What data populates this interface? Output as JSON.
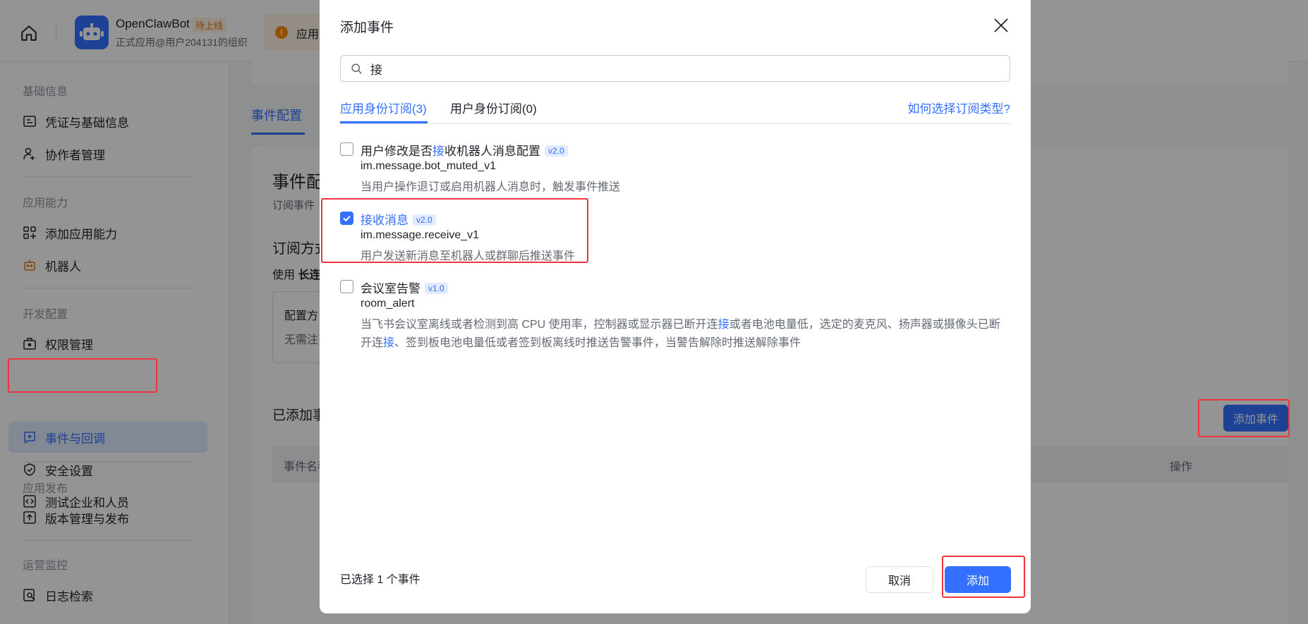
{
  "app": {
    "name": "OpenClawBot",
    "status_badge": "待上线",
    "subtitle": "正式应用@用户204131的组织",
    "notice_text": "应用"
  },
  "sidebar": {
    "groups": [
      {
        "label": "基础信息",
        "items": [
          {
            "label": "凭证与基础信息",
            "icon": "id-card-icon"
          },
          {
            "label": "协作者管理",
            "icon": "user-add-icon"
          }
        ]
      },
      {
        "label": "应用能力",
        "items": [
          {
            "label": "添加应用能力",
            "icon": "grid-add-icon"
          },
          {
            "label": "机器人",
            "icon": "robot-icon"
          }
        ]
      },
      {
        "label": "开发配置",
        "items": [
          {
            "label": "权限管理",
            "icon": "briefcase-icon"
          },
          {
            "label": "事件与回调",
            "icon": "event-icon",
            "active": true
          },
          {
            "label": "安全设置",
            "icon": "shield-icon"
          },
          {
            "label": "测试企业和人员",
            "icon": "code-box-icon"
          }
        ]
      },
      {
        "label": "应用发布",
        "items": [
          {
            "label": "版本管理与发布",
            "icon": "upload-box-icon"
          }
        ]
      },
      {
        "label": "运营监控",
        "items": [
          {
            "label": "日志检索",
            "icon": "search-doc-icon"
          }
        ]
      }
    ]
  },
  "main": {
    "tab_label": "事件配置",
    "section_title": "事件配",
    "section_sub": "订阅事件",
    "subscribe_title": "订阅方式",
    "use_text_prefix": "使用",
    "use_text_bold": "长连",
    "config_box_title": "配置方",
    "config_box_text": "无需注",
    "added_title": "已添加事",
    "table_col_name": "事件名称",
    "table_col_action": "操作",
    "add_event_button": "添加事件"
  },
  "modal": {
    "title": "添加事件",
    "search_value": "接",
    "tabs": [
      {
        "label": "应用身份订阅(3)",
        "active": true
      },
      {
        "label": "用户身份订阅(0)",
        "active": false
      }
    ],
    "help_link": "如何选择订阅类型?",
    "events": [
      {
        "name_before": "用户修改是否",
        "name_highlight": "接",
        "name_after": "收机器人消息配置",
        "version": "v2.0",
        "key": "im.message.bot_muted_v1",
        "desc_before": "当用户操作退订或启用机器人消息时，触发事件推送",
        "checked": false
      },
      {
        "name_before": "",
        "name_highlight": "接收消息",
        "name_after": "",
        "version": "v2.0",
        "key": "im.message.receive_v1",
        "desc_before": "用户发送新消息至机器人或群聊后推送事件",
        "checked": true
      },
      {
        "name_before": "会议室告警",
        "name_highlight": "",
        "name_after": "",
        "version": "v1.0",
        "key": "room_alert",
        "desc_before": "当飞书会议室离线或者检测到高 CPU 使用率，控制器或显示器已断开连",
        "desc_hl1": "接",
        "desc_mid": "或者电池电量低，选定的麦克风、扬声器或摄像头已断开连",
        "desc_hl2": "接",
        "desc_after": "、签到板电池电量低或者签到板离线时推送告警事件，当警告解除时推送解除事件",
        "checked": false
      }
    ],
    "selected_count_text": "已选择 1 个事件",
    "cancel_button": "取消",
    "add_button": "添加"
  },
  "colors": {
    "primary": "#3370ff",
    "highlight_box": "#f0343d",
    "badge_orange": "#de7802"
  }
}
